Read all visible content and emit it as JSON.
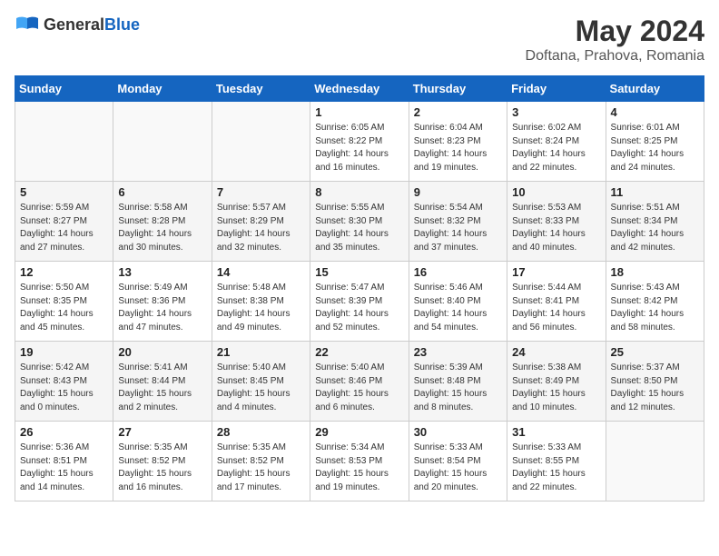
{
  "header": {
    "logo_general": "General",
    "logo_blue": "Blue",
    "month_year": "May 2024",
    "location": "Doftana, Prahova, Romania"
  },
  "days_of_week": [
    "Sunday",
    "Monday",
    "Tuesday",
    "Wednesday",
    "Thursday",
    "Friday",
    "Saturday"
  ],
  "weeks": [
    [
      {
        "day": "",
        "sunrise": "",
        "sunset": "",
        "daylight": "",
        "empty": true
      },
      {
        "day": "",
        "sunrise": "",
        "sunset": "",
        "daylight": "",
        "empty": true
      },
      {
        "day": "",
        "sunrise": "",
        "sunset": "",
        "daylight": "",
        "empty": true
      },
      {
        "day": "1",
        "sunrise": "Sunrise: 6:05 AM",
        "sunset": "Sunset: 8:22 PM",
        "daylight": "Daylight: 14 hours and 16 minutes."
      },
      {
        "day": "2",
        "sunrise": "Sunrise: 6:04 AM",
        "sunset": "Sunset: 8:23 PM",
        "daylight": "Daylight: 14 hours and 19 minutes."
      },
      {
        "day": "3",
        "sunrise": "Sunrise: 6:02 AM",
        "sunset": "Sunset: 8:24 PM",
        "daylight": "Daylight: 14 hours and 22 minutes."
      },
      {
        "day": "4",
        "sunrise": "Sunrise: 6:01 AM",
        "sunset": "Sunset: 8:25 PM",
        "daylight": "Daylight: 14 hours and 24 minutes."
      }
    ],
    [
      {
        "day": "5",
        "sunrise": "Sunrise: 5:59 AM",
        "sunset": "Sunset: 8:27 PM",
        "daylight": "Daylight: 14 hours and 27 minutes."
      },
      {
        "day": "6",
        "sunrise": "Sunrise: 5:58 AM",
        "sunset": "Sunset: 8:28 PM",
        "daylight": "Daylight: 14 hours and 30 minutes."
      },
      {
        "day": "7",
        "sunrise": "Sunrise: 5:57 AM",
        "sunset": "Sunset: 8:29 PM",
        "daylight": "Daylight: 14 hours and 32 minutes."
      },
      {
        "day": "8",
        "sunrise": "Sunrise: 5:55 AM",
        "sunset": "Sunset: 8:30 PM",
        "daylight": "Daylight: 14 hours and 35 minutes."
      },
      {
        "day": "9",
        "sunrise": "Sunrise: 5:54 AM",
        "sunset": "Sunset: 8:32 PM",
        "daylight": "Daylight: 14 hours and 37 minutes."
      },
      {
        "day": "10",
        "sunrise": "Sunrise: 5:53 AM",
        "sunset": "Sunset: 8:33 PM",
        "daylight": "Daylight: 14 hours and 40 minutes."
      },
      {
        "day": "11",
        "sunrise": "Sunrise: 5:51 AM",
        "sunset": "Sunset: 8:34 PM",
        "daylight": "Daylight: 14 hours and 42 minutes."
      }
    ],
    [
      {
        "day": "12",
        "sunrise": "Sunrise: 5:50 AM",
        "sunset": "Sunset: 8:35 PM",
        "daylight": "Daylight: 14 hours and 45 minutes."
      },
      {
        "day": "13",
        "sunrise": "Sunrise: 5:49 AM",
        "sunset": "Sunset: 8:36 PM",
        "daylight": "Daylight: 14 hours and 47 minutes."
      },
      {
        "day": "14",
        "sunrise": "Sunrise: 5:48 AM",
        "sunset": "Sunset: 8:38 PM",
        "daylight": "Daylight: 14 hours and 49 minutes."
      },
      {
        "day": "15",
        "sunrise": "Sunrise: 5:47 AM",
        "sunset": "Sunset: 8:39 PM",
        "daylight": "Daylight: 14 hours and 52 minutes."
      },
      {
        "day": "16",
        "sunrise": "Sunrise: 5:46 AM",
        "sunset": "Sunset: 8:40 PM",
        "daylight": "Daylight: 14 hours and 54 minutes."
      },
      {
        "day": "17",
        "sunrise": "Sunrise: 5:44 AM",
        "sunset": "Sunset: 8:41 PM",
        "daylight": "Daylight: 14 hours and 56 minutes."
      },
      {
        "day": "18",
        "sunrise": "Sunrise: 5:43 AM",
        "sunset": "Sunset: 8:42 PM",
        "daylight": "Daylight: 14 hours and 58 minutes."
      }
    ],
    [
      {
        "day": "19",
        "sunrise": "Sunrise: 5:42 AM",
        "sunset": "Sunset: 8:43 PM",
        "daylight": "Daylight: 15 hours and 0 minutes."
      },
      {
        "day": "20",
        "sunrise": "Sunrise: 5:41 AM",
        "sunset": "Sunset: 8:44 PM",
        "daylight": "Daylight: 15 hours and 2 minutes."
      },
      {
        "day": "21",
        "sunrise": "Sunrise: 5:40 AM",
        "sunset": "Sunset: 8:45 PM",
        "daylight": "Daylight: 15 hours and 4 minutes."
      },
      {
        "day": "22",
        "sunrise": "Sunrise: 5:40 AM",
        "sunset": "Sunset: 8:46 PM",
        "daylight": "Daylight: 15 hours and 6 minutes."
      },
      {
        "day": "23",
        "sunrise": "Sunrise: 5:39 AM",
        "sunset": "Sunset: 8:48 PM",
        "daylight": "Daylight: 15 hours and 8 minutes."
      },
      {
        "day": "24",
        "sunrise": "Sunrise: 5:38 AM",
        "sunset": "Sunset: 8:49 PM",
        "daylight": "Daylight: 15 hours and 10 minutes."
      },
      {
        "day": "25",
        "sunrise": "Sunrise: 5:37 AM",
        "sunset": "Sunset: 8:50 PM",
        "daylight": "Daylight: 15 hours and 12 minutes."
      }
    ],
    [
      {
        "day": "26",
        "sunrise": "Sunrise: 5:36 AM",
        "sunset": "Sunset: 8:51 PM",
        "daylight": "Daylight: 15 hours and 14 minutes."
      },
      {
        "day": "27",
        "sunrise": "Sunrise: 5:35 AM",
        "sunset": "Sunset: 8:52 PM",
        "daylight": "Daylight: 15 hours and 16 minutes."
      },
      {
        "day": "28",
        "sunrise": "Sunrise: 5:35 AM",
        "sunset": "Sunset: 8:52 PM",
        "daylight": "Daylight: 15 hours and 17 minutes."
      },
      {
        "day": "29",
        "sunrise": "Sunrise: 5:34 AM",
        "sunset": "Sunset: 8:53 PM",
        "daylight": "Daylight: 15 hours and 19 minutes."
      },
      {
        "day": "30",
        "sunrise": "Sunrise: 5:33 AM",
        "sunset": "Sunset: 8:54 PM",
        "daylight": "Daylight: 15 hours and 20 minutes."
      },
      {
        "day": "31",
        "sunrise": "Sunrise: 5:33 AM",
        "sunset": "Sunset: 8:55 PM",
        "daylight": "Daylight: 15 hours and 22 minutes."
      },
      {
        "day": "",
        "sunrise": "",
        "sunset": "",
        "daylight": "",
        "empty": true
      }
    ]
  ]
}
